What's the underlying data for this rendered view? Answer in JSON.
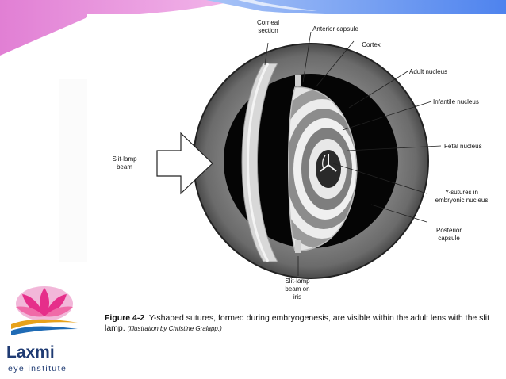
{
  "labels": {
    "corneal_section": "Corneal\nsection",
    "anterior_capsule": "Anterior capsule",
    "cortex": "Cortex",
    "adult_nucleus": "Adult nucleus",
    "infantile_nucleus": "Infantile nucleus",
    "fetal_nucleus": "Fetal nucleus",
    "slit_lamp_beam": "Slit-lamp\nbeam",
    "y_sutures": "Y-sutures in\nembryonic nucleus",
    "posterior_capsule": "Posterior\ncapsule",
    "slit_lamp_beam_on_iris": "Slit-lamp\nbeam on\niris"
  },
  "caption": {
    "figure_number": "Figure 4-2",
    "text": "Y-shaped sutures, formed during embryogenesis, are visible within the adult lens with the slit lamp.",
    "credit": "(Illustration by Christine Gralapp.)"
  },
  "logo": {
    "name": "Laxmi",
    "tagline": "eye institute"
  },
  "colors": {
    "banner_pink": "#e58bd9",
    "banner_blue": "#5b8def",
    "logo_blue": "#1f3b73",
    "logo_pink": "#e62e8a",
    "logo_gold": "#e8a21a"
  }
}
